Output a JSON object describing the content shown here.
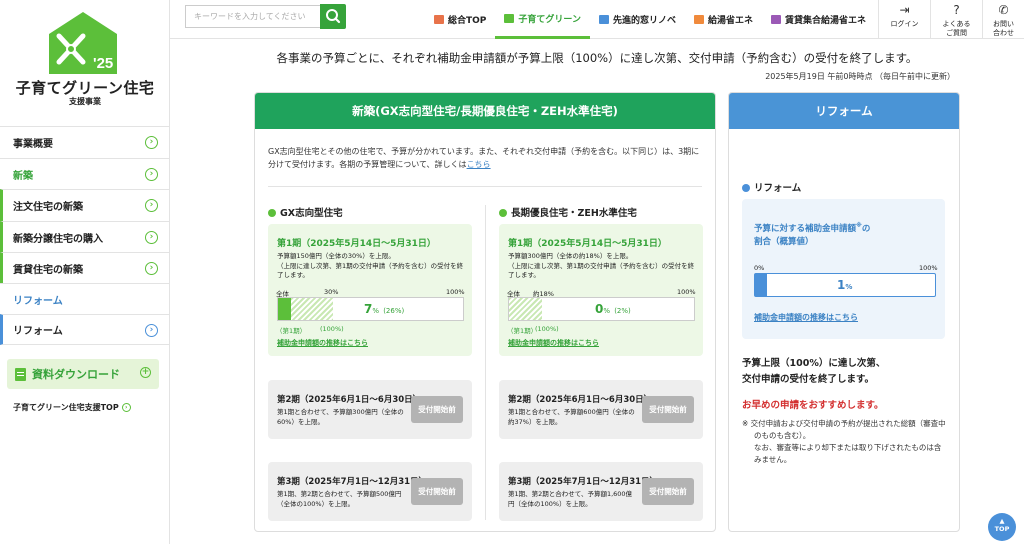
{
  "logo": {
    "year": "'25",
    "title": "子育てグリーン住宅",
    "subtitle": "支援事業"
  },
  "sidebar": {
    "items": [
      {
        "label": "事業概要"
      },
      {
        "label": "新築"
      },
      {
        "label": "注文住宅の新築"
      },
      {
        "label": "新築分譲住宅の購入"
      },
      {
        "label": "賃貸住宅の新築"
      },
      {
        "label": "リフォーム"
      },
      {
        "label": "リフォーム"
      }
    ],
    "download_label": "資料ダウンロード",
    "top_link": "子育てグリーン住宅支援TOP"
  },
  "header": {
    "search_placeholder": "キーワードを入力してください",
    "tabs": [
      {
        "label": "総合TOP",
        "color": "#e8734a"
      },
      {
        "label": "子育てグリーン",
        "color": "#5cbf3a"
      },
      {
        "label": "先進的窓リノベ",
        "color": "#4a90d9"
      },
      {
        "label": "給湯省エネ",
        "color": "#f08a3c"
      },
      {
        "label": "賃貸集合給湯省エネ",
        "color": "#9b59b6"
      }
    ],
    "tools": [
      {
        "label1": "ログイン",
        "label2": ""
      },
      {
        "label1": "よくある",
        "label2": "ご質問"
      },
      {
        "label1": "お問い",
        "label2": "合わせ"
      }
    ]
  },
  "notice": "各事業の予算ごとに、それぞれ補助金申請額が予算上限（100%）に達し次第、交付申請（予約含む）の受付を終了します。",
  "date": "2025年5月19日 午前0時時点 （毎日午前中に更新）",
  "new_card": {
    "title": "新築(GX志向型住宅/長期優良住宅・ZEH水準住宅)",
    "desc": "GX志向型住宅とその他の住宅で、予算が分かれています。また、それぞれ交付申請（予約を含む。以下同じ）は、3期に分けて受付けます。各期の予算管理について、詳しくは",
    "desc_link": "こちら",
    "gx": {
      "title": "GX志向型住宅",
      "p1": {
        "title": "第1期（2025年5月14日〜5月31日）",
        "desc1": "予算額150億円（全体の30%）を上限。",
        "desc2": "（上限に達し次第、第1期の交付申請（予約を含む）の受付を終了します。",
        "scale_left": "全体",
        "scale_mid": "30%",
        "scale_right": "100%",
        "pct": "7",
        "pct_unit": "%",
        "pct_sub": "(26%)",
        "progress": 0.07,
        "period_share": 0.3,
        "label_left": "（第1期）",
        "label_right": "(100%)",
        "link": "補助金申請額の推移はこちら"
      },
      "p2": {
        "title": "第2期（2025年6月1日〜6月30日）",
        "desc": "第1期と合わせて、予算額300億円（全体の60%）を上限。",
        "btn": "受付開始前"
      },
      "p3": {
        "title": "第3期（2025年7月1日〜12月31日）",
        "desc": "第1期、第2期と合わせて、予算額500億円（全体の100%）を上限。",
        "btn": "受付開始前"
      }
    },
    "zeh": {
      "title": "長期優良住宅・ZEH水準住宅",
      "p1": {
        "title": "第1期（2025年5月14日〜5月31日）",
        "desc1": "予算額300億円（全体の約18%）を上限。",
        "desc2": "（上限に達し次第、第1期の交付申請（予約を含む）の受付を終了します。",
        "scale_left": "全体",
        "scale_mid": "約18%",
        "scale_right": "100%",
        "pct": "0",
        "pct_unit": "%",
        "pct_sub": "(2%)",
        "progress": 0.0,
        "period_share": 0.18,
        "label_left": "（第1期）",
        "label_right": "(100%)",
        "link": "補助金申請額の推移はこちら"
      },
      "p2": {
        "title": "第2期（2025年6月1日〜6月30日）",
        "desc": "第1期と合わせて、予算額600億円（全体の約37%）を上限。",
        "btn": "受付開始前"
      },
      "p3": {
        "title": "第3期（2025年7月1日〜12月31日）",
        "desc": "第1期、第2期と合わせて、予算額1,600億円（全体の100%）を上限。",
        "btn": "受付開始前"
      }
    }
  },
  "reform_card": {
    "title": "リフォーム",
    "section": "リフォーム",
    "box_title": "予算に対する補助金申請額",
    "box_title_sup": "※",
    "box_title_suffix": "の",
    "box_title2": "割合（概算値）",
    "scale_left": "0%",
    "scale_right": "100%",
    "pct": "1",
    "pct_unit": "%",
    "progress": 0.01,
    "link": "補助金申請額の推移はこちら",
    "msg1": "予算上限（100%）に達し次第、",
    "msg2": "交付申請の受付を終了します。",
    "red": "お早めの申請をおすすめします。",
    "note1": "※ 交付申請および交付申請の予約が提出された総額（審査中のものも含む）。",
    "note2": "なお、審査等により却下または取り下げされたものは含みません。"
  },
  "totop": "TOP"
}
